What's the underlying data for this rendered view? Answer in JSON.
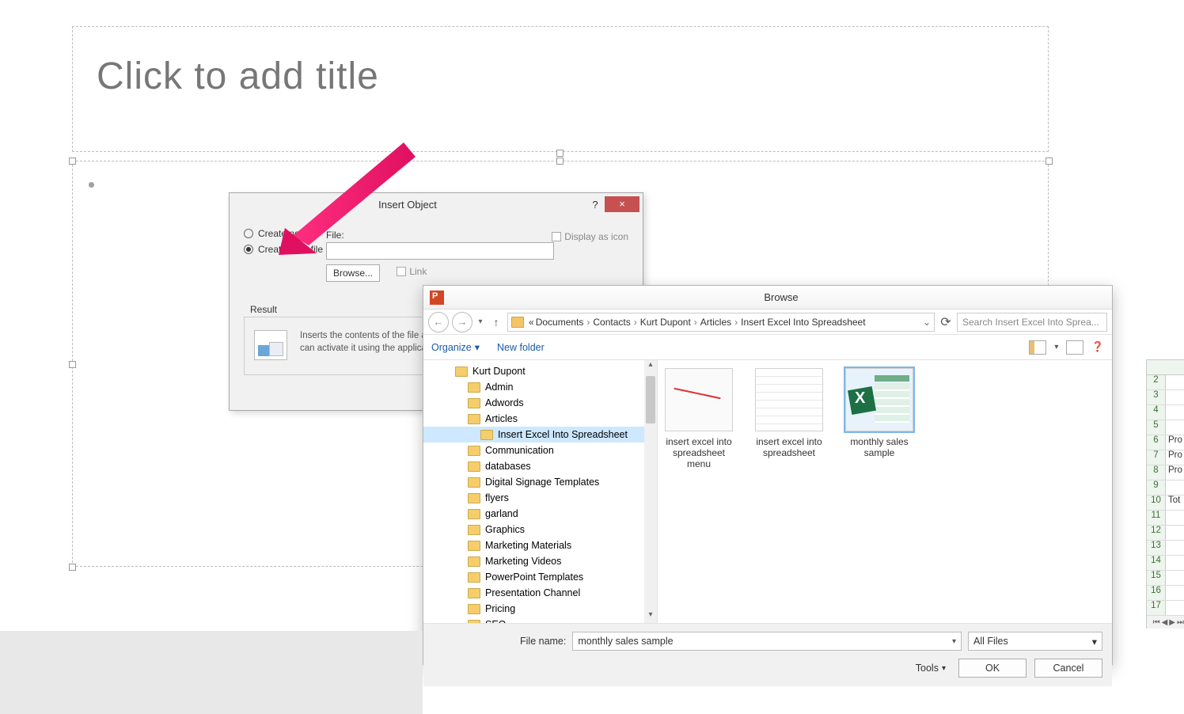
{
  "slide": {
    "title_placeholder": "Click to add title"
  },
  "insert_dialog": {
    "title": "Insert Object",
    "radio_new": "Create new",
    "radio_file": "Create from file",
    "file_label": "File:",
    "browse_btn": "Browse...",
    "link_label": "Link",
    "display_icon_label": "Display as icon",
    "result_heading": "Result",
    "result_text": "Inserts the contents of the file as an object into your presentation so that you can activate it using the application that created it."
  },
  "browse_dialog": {
    "title": "Browse",
    "breadcrumb": [
      "Documents",
      "Contacts",
      "Kurt Dupont",
      "Articles",
      "Insert Excel Into Spreadsheet"
    ],
    "breadcrumb_prefix": "«",
    "search_placeholder": "Search Insert Excel Into Sprea...",
    "organize": "Organize",
    "new_folder": "New folder",
    "tree": [
      {
        "label": "Kurt Dupont",
        "depth": 1
      },
      {
        "label": "Admin",
        "depth": 2
      },
      {
        "label": "Adwords",
        "depth": 2
      },
      {
        "label": "Articles",
        "depth": 2
      },
      {
        "label": "Insert Excel Into Spreadsheet",
        "depth": 3,
        "selected": true
      },
      {
        "label": "Communication",
        "depth": 2
      },
      {
        "label": "databases",
        "depth": 2
      },
      {
        "label": "Digital Signage Templates",
        "depth": 2
      },
      {
        "label": "flyers",
        "depth": 2
      },
      {
        "label": "garland",
        "depth": 2
      },
      {
        "label": "Graphics",
        "depth": 2
      },
      {
        "label": "Marketing Materials",
        "depth": 2
      },
      {
        "label": "Marketing Videos",
        "depth": 2
      },
      {
        "label": "PowerPoint Templates",
        "depth": 2
      },
      {
        "label": "Presentation Channel",
        "depth": 2
      },
      {
        "label": "Pricing",
        "depth": 2
      },
      {
        "label": "SEO",
        "depth": 2
      }
    ],
    "files": [
      {
        "label": "insert excel into spreadsheet menu",
        "kind": "ppt"
      },
      {
        "label": "insert excel into spreadsheet",
        "kind": "ss"
      },
      {
        "label": "monthly sales sample",
        "kind": "xlsx",
        "selected": true
      }
    ],
    "file_name_label": "File name:",
    "file_name_value": "monthly sales sample",
    "filter": "All Files",
    "tools": "Tools",
    "ok": "OK",
    "cancel": "Cancel"
  },
  "mini_sheet": {
    "rows": [
      {
        "n": "2",
        "v": ""
      },
      {
        "n": "3",
        "v": ""
      },
      {
        "n": "4",
        "v": ""
      },
      {
        "n": "5",
        "v": ""
      },
      {
        "n": "6",
        "v": "Pro"
      },
      {
        "n": "7",
        "v": "Pro"
      },
      {
        "n": "8",
        "v": "Pro"
      },
      {
        "n": "9",
        "v": ""
      },
      {
        "n": "10",
        "v": "Tot"
      },
      {
        "n": "11",
        "v": ""
      },
      {
        "n": "12",
        "v": ""
      },
      {
        "n": "13",
        "v": ""
      },
      {
        "n": "14",
        "v": ""
      },
      {
        "n": "15",
        "v": ""
      },
      {
        "n": "16",
        "v": ""
      },
      {
        "n": "17",
        "v": ""
      }
    ]
  }
}
